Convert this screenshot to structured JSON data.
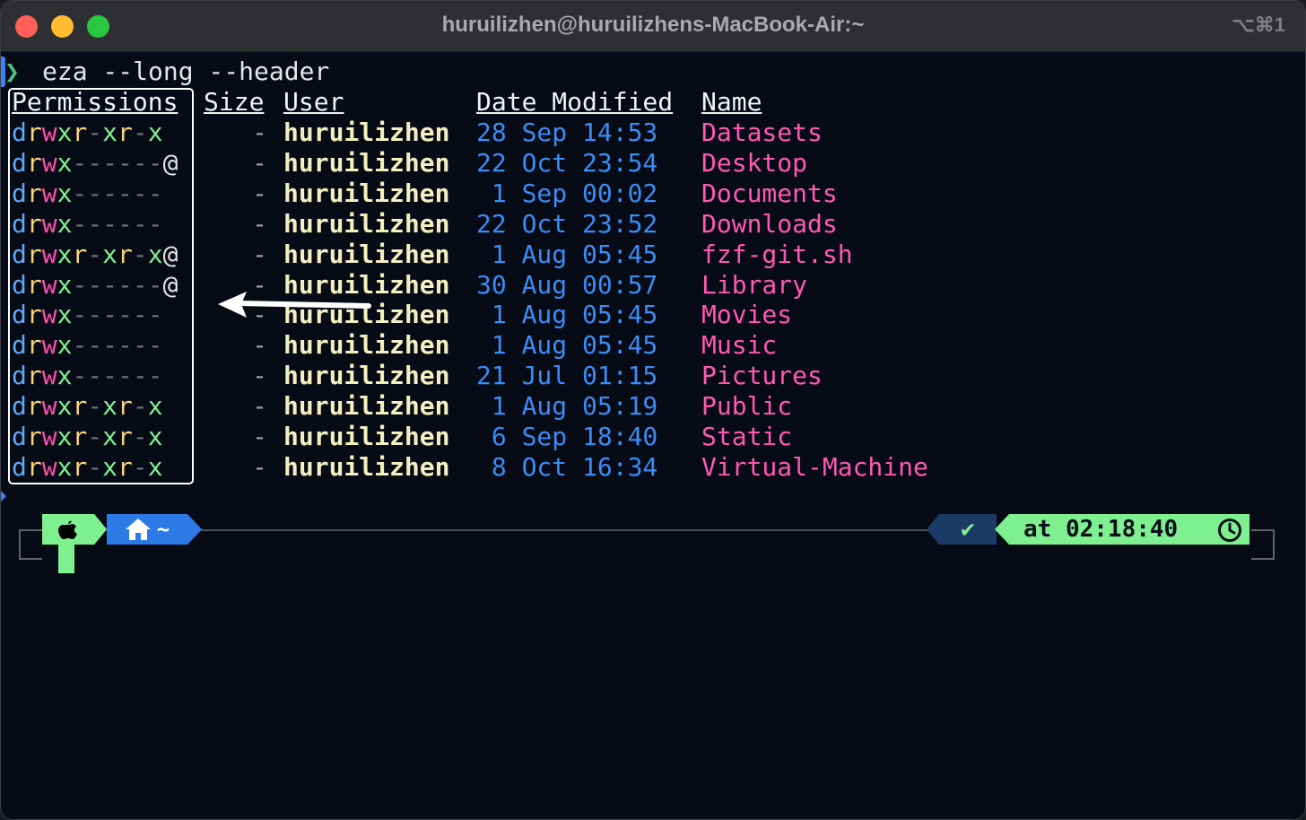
{
  "window": {
    "title": "huruilizhen@huruilizhens-MacBook-Air:~",
    "shortcut": "⌥⌘1"
  },
  "command": {
    "prompt_symbol": "❯",
    "text": "eza --long --header"
  },
  "headers": {
    "permissions": "Permissions",
    "size": "Size",
    "user": "User",
    "date_modified": "Date Modified",
    "name": "Name"
  },
  "rows": [
    {
      "perm_d": "d",
      "perm_r1": "r",
      "perm_w": "w",
      "perm_x1": "x",
      "perm_rest": "r-xr-x",
      "perm_at": "",
      "size": "-",
      "user": "huruilizhen",
      "date": "28 Sep 14:53",
      "name": "Datasets"
    },
    {
      "perm_d": "d",
      "perm_r1": "r",
      "perm_w": "w",
      "perm_x1": "x",
      "perm_rest": "------",
      "perm_at": "@",
      "size": "-",
      "user": "huruilizhen",
      "date": "22 Oct 23:54",
      "name": "Desktop"
    },
    {
      "perm_d": "d",
      "perm_r1": "r",
      "perm_w": "w",
      "perm_x1": "x",
      "perm_rest": "------",
      "perm_at": "",
      "size": "-",
      "user": "huruilizhen",
      "date": " 1 Sep 00:02",
      "name": "Documents"
    },
    {
      "perm_d": "d",
      "perm_r1": "r",
      "perm_w": "w",
      "perm_x1": "x",
      "perm_rest": "------",
      "perm_at": "",
      "size": "-",
      "user": "huruilizhen",
      "date": "22 Oct 23:52",
      "name": "Downloads"
    },
    {
      "perm_d": "d",
      "perm_r1": "r",
      "perm_w": "w",
      "perm_x1": "x",
      "perm_rest": "r-xr-x",
      "perm_at": "@",
      "size": "-",
      "user": "huruilizhen",
      "date": " 1 Aug 05:45",
      "name": "fzf-git.sh"
    },
    {
      "perm_d": "d",
      "perm_r1": "r",
      "perm_w": "w",
      "perm_x1": "x",
      "perm_rest": "------",
      "perm_at": "@",
      "size": "-",
      "user": "huruilizhen",
      "date": "30 Aug 00:57",
      "name": "Library"
    },
    {
      "perm_d": "d",
      "perm_r1": "r",
      "perm_w": "w",
      "perm_x1": "x",
      "perm_rest": "------",
      "perm_at": "",
      "size": "-",
      "user": "huruilizhen",
      "date": " 1 Aug 05:45",
      "name": "Movies"
    },
    {
      "perm_d": "d",
      "perm_r1": "r",
      "perm_w": "w",
      "perm_x1": "x",
      "perm_rest": "------",
      "perm_at": "",
      "size": "-",
      "user": "huruilizhen",
      "date": " 1 Aug 05:45",
      "name": "Music"
    },
    {
      "perm_d": "d",
      "perm_r1": "r",
      "perm_w": "w",
      "perm_x1": "x",
      "perm_rest": "------",
      "perm_at": "",
      "size": "-",
      "user": "huruilizhen",
      "date": "21 Jul 01:15",
      "name": "Pictures"
    },
    {
      "perm_d": "d",
      "perm_r1": "r",
      "perm_w": "w",
      "perm_x1": "x",
      "perm_rest": "r-xr-x",
      "perm_at": "",
      "size": "-",
      "user": "huruilizhen",
      "date": " 1 Aug 05:19",
      "name": "Public"
    },
    {
      "perm_d": "d",
      "perm_r1": "r",
      "perm_w": "w",
      "perm_x1": "x",
      "perm_rest": "r-xr-x",
      "perm_at": "",
      "size": "-",
      "user": "huruilizhen",
      "date": " 6 Sep 18:40",
      "name": "Static"
    },
    {
      "perm_d": "d",
      "perm_r1": "r",
      "perm_w": "w",
      "perm_x1": "x",
      "perm_rest": "r-xr-x",
      "perm_at": "",
      "size": "-",
      "user": "huruilizhen",
      "date": " 8 Oct 16:34",
      "name": "Virtual-Machine"
    }
  ],
  "statusline": {
    "os_icon": "apple-icon",
    "dir_icon": "home-icon",
    "dir": "~",
    "status_mark": "✔",
    "time_text": "at 02:18:40",
    "time_icon": "clock-icon"
  },
  "colors": {
    "background": "#070b16",
    "directory": "#ff58b4",
    "date": "#3b8cf5",
    "user": "#f4efbf",
    "powerline_green": "#7ef08f",
    "powerline_blue": "#2b7ae6"
  }
}
